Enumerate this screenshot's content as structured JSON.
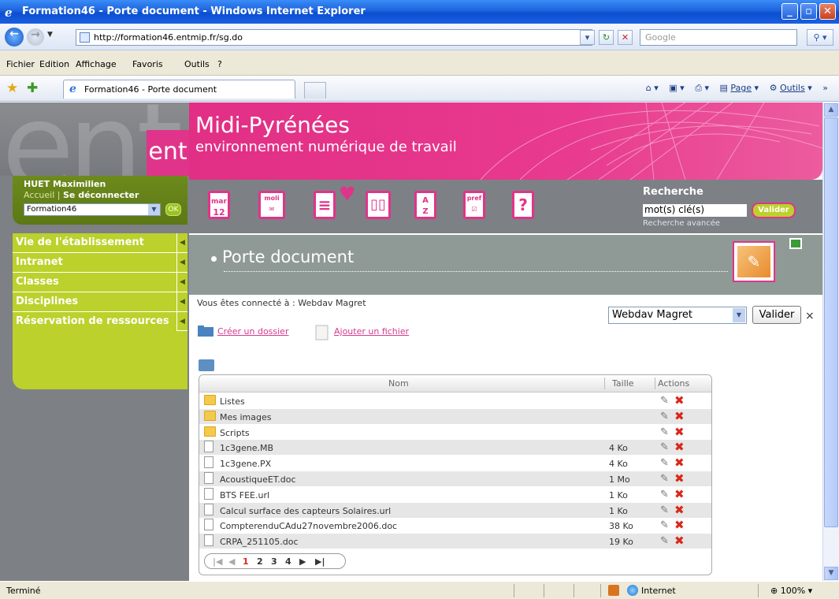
{
  "window": {
    "title": "Formation46 - Porte document - Windows Internet Explorer",
    "url": "http://formation46.entmip.fr/sg.do",
    "search_placeholder": "Google",
    "menu": [
      "Fichier",
      "Edition",
      "Affichage",
      "Favoris",
      "Outils",
      "?"
    ],
    "tab_title": "Formation46 - Porte document",
    "commands": {
      "page": "Page",
      "tools": "Outils"
    },
    "status": "Terminé",
    "zone": "Internet",
    "zoom": "100%"
  },
  "site": {
    "logo_text": "ent",
    "banner_title": "Midi-Pyrénées",
    "banner_subtitle": "environnement numérique de travail",
    "user_name": "HUET Maximilien",
    "home_link": "Accueil",
    "logout_link": "Se déconnecter",
    "site_selected": "Formation46",
    "ok_label": "OK",
    "nav": [
      {
        "label": "Vie de l'établissement"
      },
      {
        "label": "Intranet"
      },
      {
        "label": "Classes"
      },
      {
        "label": "Disciplines"
      },
      {
        "label": "Réservation de ressources"
      }
    ],
    "tools": {
      "agenda_month": "mar",
      "agenda_day": "12",
      "mail_label": "moli",
      "pref_label": "pref",
      "help_label": "?"
    },
    "search": {
      "label": "Recherche",
      "value": "mot(s) clé(s)",
      "button": "Valider",
      "advanced": "Recherche avancée"
    }
  },
  "page": {
    "title": "Porte document",
    "connected_to": "Vous êtes connecté à : Webdav Magret",
    "create_folder": "Créer un dossier",
    "upload_file": "Ajouter un fichier",
    "source_selected": "Webdav Magret",
    "source_button": "Valider",
    "close_glyph": "×",
    "columns": {
      "name": "Nom",
      "size": "Taille",
      "actions": "Actions"
    },
    "rows": [
      {
        "name": "Listes",
        "type": "folder",
        "size": ""
      },
      {
        "name": "Mes images",
        "type": "folder",
        "size": ""
      },
      {
        "name": "Scripts",
        "type": "folder",
        "size": ""
      },
      {
        "name": "1c3gene.MB",
        "type": "file",
        "size": "4 Ko"
      },
      {
        "name": "1c3gene.PX",
        "type": "file",
        "size": "4 Ko"
      },
      {
        "name": "AcoustiqueET.doc",
        "type": "file",
        "size": "1 Mo"
      },
      {
        "name": "BTS FEE.url",
        "type": "file",
        "size": "1 Ko"
      },
      {
        "name": "Calcul surface des capteurs Solaires.url",
        "type": "file",
        "size": "1 Ko"
      },
      {
        "name": "CompterenduCAdu27novembre2006.doc",
        "type": "file",
        "size": "38 Ko"
      },
      {
        "name": "CRPA_251105.doc",
        "type": "file",
        "size": "19 Ko"
      }
    ],
    "pager": {
      "pages": [
        "1",
        "2",
        "3",
        "4"
      ],
      "current": "1"
    }
  }
}
